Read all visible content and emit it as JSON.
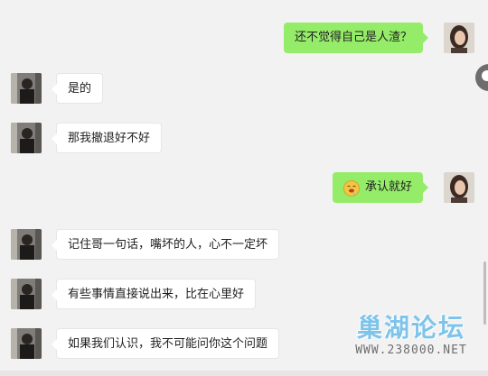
{
  "messages": [
    {
      "side": "right",
      "text": "还不觉得自己是人渣？"
    },
    {
      "side": "left",
      "text": "是的"
    },
    {
      "side": "left",
      "text": "那我撤退好不好"
    },
    {
      "side": "right",
      "text": "承认就好",
      "emoji": "drooling-face-emoji"
    },
    {
      "side": "left",
      "text": "记住哥一句话，嘴坏的人，心不一定坏"
    },
    {
      "side": "left",
      "text": "有些事情直接说出来，比在心里好"
    },
    {
      "side": "left",
      "text": "如果我们认识，我不可能问你这个问题"
    }
  ],
  "watermark": {
    "title": "巢湖论坛",
    "url": "WWW.238000.NET"
  },
  "colors": {
    "background": "#f2f2f2",
    "incoming_bubble": "#ffffff",
    "outgoing_bubble": "#95ec69"
  }
}
